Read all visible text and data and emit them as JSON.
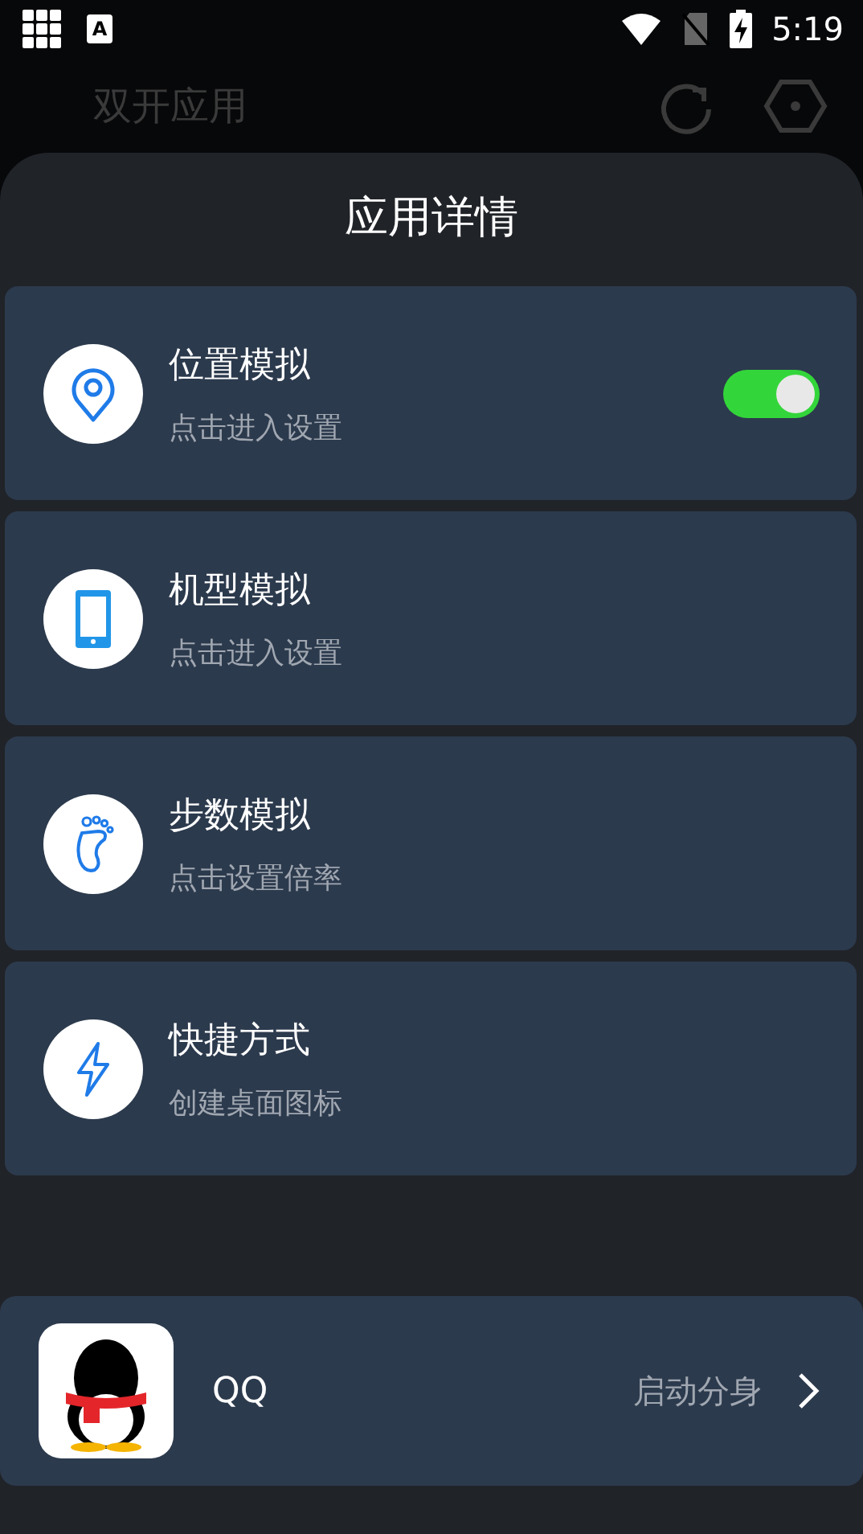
{
  "status_bar": {
    "input_badge": "A",
    "time": "5:19"
  },
  "app_bar": {
    "title": "双开应用"
  },
  "sheet": {
    "title": "应用详情",
    "items": [
      {
        "kind": "toggle",
        "title": "位置模拟",
        "subtitle": "点击进入设置",
        "on": true
      },
      {
        "kind": "plain",
        "title": "机型模拟",
        "subtitle": "点击进入设置"
      },
      {
        "kind": "plain",
        "title": "步数模拟",
        "subtitle": "点击设置倍率"
      },
      {
        "kind": "plain",
        "title": "快捷方式",
        "subtitle": "创建桌面图标"
      }
    ]
  },
  "app": {
    "name": "QQ",
    "action": "启动分身"
  }
}
